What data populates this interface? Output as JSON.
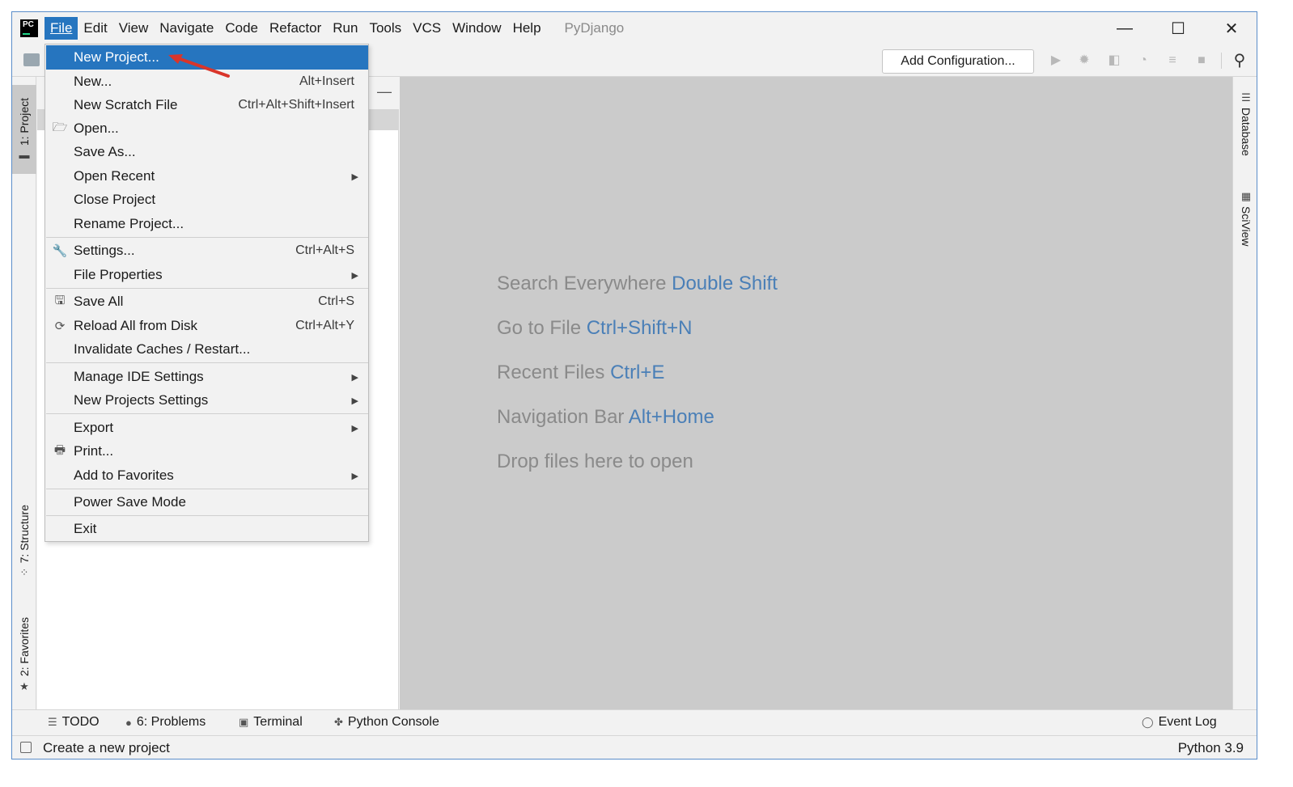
{
  "app": {
    "logo_text": "PC",
    "window_title": "PyDjango"
  },
  "menubar": [
    {
      "label": "File",
      "underline": "F",
      "active": true
    },
    {
      "label": "Edit",
      "underline": "E"
    },
    {
      "label": "View",
      "underline": "V"
    },
    {
      "label": "Navigate",
      "underline": "N"
    },
    {
      "label": "Code",
      "underline": "C"
    },
    {
      "label": "Refactor",
      "underline": "R"
    },
    {
      "label": "Run",
      "underline": "u"
    },
    {
      "label": "Tools",
      "underline": "T"
    },
    {
      "label": "VCS",
      "underline": "S"
    },
    {
      "label": "Window",
      "underline": "W"
    },
    {
      "label": "Help",
      "underline": "H"
    }
  ],
  "window_controls": {
    "minimize": "—",
    "maximize": "☐",
    "close": "✕"
  },
  "toolbar": {
    "add_configuration": "Add Configuration..."
  },
  "left_strip": {
    "project": "1: Project",
    "structure": "7: Structure",
    "favorites": "2: Favorites"
  },
  "right_strip": {
    "database": "Database",
    "sciview": "SciView"
  },
  "file_menu": {
    "items": [
      {
        "label": "New Project...",
        "shortcut": "",
        "icon": "",
        "submenu": false,
        "highlighted": true
      },
      {
        "label": "New...",
        "shortcut": "Alt+Insert",
        "icon": "",
        "submenu": false
      },
      {
        "label": "New Scratch File",
        "shortcut": "Ctrl+Alt+Shift+Insert",
        "icon": "",
        "submenu": false
      },
      {
        "label": "Open...",
        "shortcut": "",
        "icon": "folder-open-icon",
        "submenu": false
      },
      {
        "label": "Save As...",
        "shortcut": "",
        "icon": "",
        "submenu": false
      },
      {
        "label": "Open Recent",
        "shortcut": "",
        "icon": "",
        "submenu": true
      },
      {
        "label": "Close Project",
        "shortcut": "",
        "icon": "",
        "submenu": false
      },
      {
        "label": "Rename Project...",
        "shortcut": "",
        "icon": "",
        "submenu": false
      },
      {
        "label": "Settings...",
        "shortcut": "Ctrl+Alt+S",
        "icon": "wrench-icon",
        "submenu": false
      },
      {
        "label": "File Properties",
        "shortcut": "",
        "icon": "",
        "submenu": true
      },
      {
        "label": "Save All",
        "shortcut": "Ctrl+S",
        "icon": "save-icon",
        "submenu": false
      },
      {
        "label": "Reload All from Disk",
        "shortcut": "Ctrl+Alt+Y",
        "icon": "reload-icon",
        "submenu": false
      },
      {
        "label": "Invalidate Caches / Restart...",
        "shortcut": "",
        "icon": "",
        "submenu": false
      },
      {
        "label": "Manage IDE Settings",
        "shortcut": "",
        "icon": "",
        "submenu": true
      },
      {
        "label": "New Projects Settings",
        "shortcut": "",
        "icon": "",
        "submenu": true
      },
      {
        "label": "Export",
        "shortcut": "",
        "icon": "",
        "submenu": true
      },
      {
        "label": "Print...",
        "shortcut": "",
        "icon": "printer-icon",
        "submenu": false
      },
      {
        "label": "Add to Favorites",
        "shortcut": "",
        "icon": "",
        "submenu": true
      },
      {
        "label": "Power Save Mode",
        "shortcut": "",
        "icon": "",
        "submenu": false
      },
      {
        "label": "Exit",
        "shortcut": "",
        "icon": "",
        "submenu": false
      }
    ]
  },
  "editor_hints": [
    {
      "text": "Search Everywhere",
      "key": "Double Shift"
    },
    {
      "text": "Go to File",
      "key": "Ctrl+Shift+N"
    },
    {
      "text": "Recent Files",
      "key": "Ctrl+E"
    },
    {
      "text": "Navigation Bar",
      "key": "Alt+Home"
    },
    {
      "text": "Drop files here to open",
      "key": ""
    }
  ],
  "bottom_bar": {
    "todo": "TODO",
    "problems": "6: Problems",
    "terminal": "Terminal",
    "python_console": "Python Console",
    "event_log": "Event Log"
  },
  "status_bar": {
    "message": "Create a new project",
    "interpreter": "Python 3.9"
  },
  "colors": {
    "accent": "#2675bf",
    "hint_key": "#4a7fb7",
    "annotation_arrow": "#d9352a"
  }
}
